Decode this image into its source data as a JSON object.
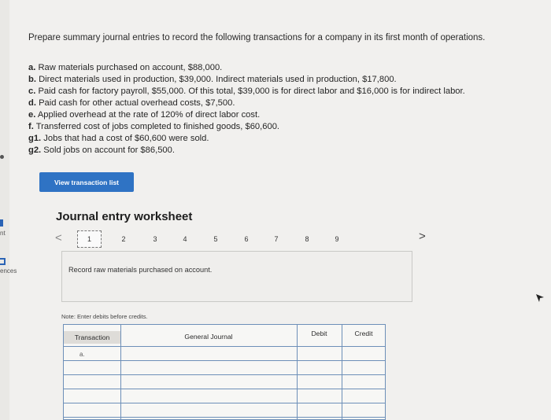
{
  "edge": {
    "label_nt": "nt",
    "label_ences": "ences"
  },
  "problem": {
    "intro": "Prepare summary journal entries to record the following transactions for a company in its first month of operations.",
    "transactions": [
      {
        "key": "a.",
        "text": "Raw materials purchased on account, $88,000."
      },
      {
        "key": "b.",
        "text": "Direct materials used in production, $39,000. Indirect materials used in production, $17,800."
      },
      {
        "key": "c.",
        "text": "Paid cash for factory payroll, $55,000. Of this total, $39,000 is for direct labor and $16,000 is for indirect labor."
      },
      {
        "key": "d.",
        "text": "Paid cash for other actual overhead costs, $7,500."
      },
      {
        "key": "e.",
        "text": "Applied overhead at the rate of 120% of direct labor cost."
      },
      {
        "key": "f.",
        "text": "Transferred cost of jobs completed to finished goods, $60,600."
      },
      {
        "key": "g1.",
        "text": "Jobs that had a cost of $60,600 were sold."
      },
      {
        "key": "g2.",
        "text": "Sold jobs on account for $86,500."
      }
    ]
  },
  "buttons": {
    "view_transactions": "View transaction list"
  },
  "worksheet": {
    "title": "Journal entry worksheet",
    "prev_symbol": "<",
    "next_symbol": ">",
    "pages": [
      "1",
      "2",
      "3",
      "4",
      "5",
      "6",
      "7",
      "8",
      "9"
    ],
    "active_page": "1",
    "record_instruction": "Record raw materials purchased on account.",
    "note": "Note: Enter debits before credits."
  },
  "journal_table": {
    "headers": {
      "transaction": "Transaction",
      "general_journal": "General Journal",
      "debit": "Debit",
      "credit": "Credit"
    },
    "first_row_transaction": "a."
  },
  "colors": {
    "accent": "#2f73c4",
    "table_border": "#6d8fb8"
  }
}
